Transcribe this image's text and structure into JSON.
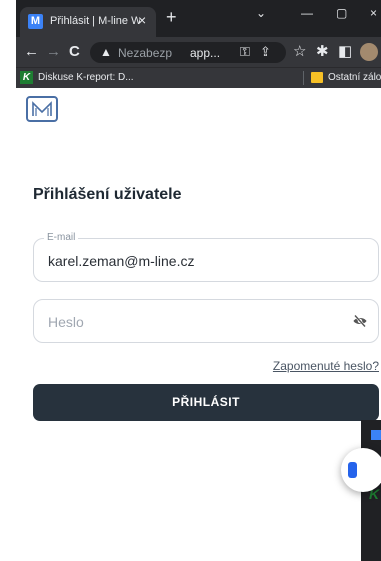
{
  "tab": {
    "title": "Přihlásit | M-line WebApp",
    "favicon": "M"
  },
  "toolbar": {
    "security_label": "Nezabezp",
    "address": "app..."
  },
  "bookmarks": {
    "item1_icon": "K",
    "item1": "Diskuse K-report: D...",
    "other": "Ostatní zálož"
  },
  "page": {
    "heading": "Přihlášení uživatele",
    "email_label": "E-mail",
    "email_value": "karel.zeman@m-line.cz",
    "password_placeholder": "Heslo",
    "forgot_link": "Zapomenuté heslo?",
    "login_button": "PŘIHLÁSIT"
  },
  "icons": {
    "brand_color": "#4a6fa5",
    "button_color": "#27323d",
    "eye_icon": "eye-off-icon"
  }
}
